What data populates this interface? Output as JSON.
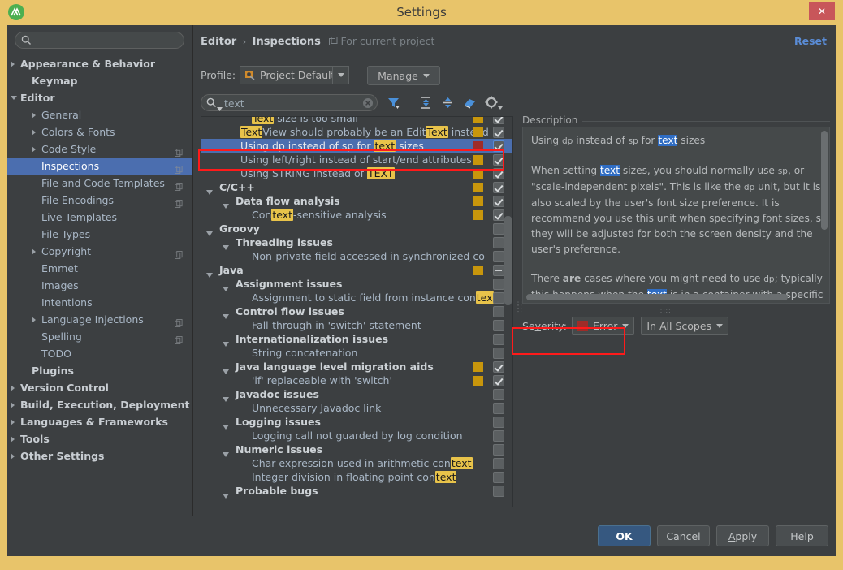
{
  "window": {
    "title": "Settings",
    "app_icon": "android-studio-icon",
    "close_label": "✕"
  },
  "sidebar": {
    "search_placeholder": "",
    "search_value": "",
    "items": [
      {
        "label": "Appearance & Behavior",
        "indent": 16,
        "arrow": "closed",
        "bold": true,
        "selected": false,
        "copy": false
      },
      {
        "label": "Keymap",
        "indent": 30,
        "arrow": "none",
        "bold": true,
        "selected": false,
        "copy": false
      },
      {
        "label": "Editor",
        "indent": 16,
        "arrow": "open",
        "bold": true,
        "selected": false,
        "copy": false
      },
      {
        "label": "General",
        "indent": 42,
        "arrow": "closed",
        "bold": false,
        "selected": false,
        "copy": false
      },
      {
        "label": "Colors & Fonts",
        "indent": 42,
        "arrow": "closed",
        "bold": false,
        "selected": false,
        "copy": false
      },
      {
        "label": "Code Style",
        "indent": 42,
        "arrow": "closed",
        "bold": false,
        "selected": false,
        "copy": true
      },
      {
        "label": "Inspections",
        "indent": 42,
        "arrow": "none",
        "bold": false,
        "selected": true,
        "copy": true
      },
      {
        "label": "File and Code Templates",
        "indent": 42,
        "arrow": "none",
        "bold": false,
        "selected": false,
        "copy": true
      },
      {
        "label": "File Encodings",
        "indent": 42,
        "arrow": "none",
        "bold": false,
        "selected": false,
        "copy": true
      },
      {
        "label": "Live Templates",
        "indent": 42,
        "arrow": "none",
        "bold": false,
        "selected": false,
        "copy": false
      },
      {
        "label": "File Types",
        "indent": 42,
        "arrow": "none",
        "bold": false,
        "selected": false,
        "copy": false
      },
      {
        "label": "Copyright",
        "indent": 42,
        "arrow": "closed",
        "bold": false,
        "selected": false,
        "copy": true
      },
      {
        "label": "Emmet",
        "indent": 42,
        "arrow": "none",
        "bold": false,
        "selected": false,
        "copy": false
      },
      {
        "label": "Images",
        "indent": 42,
        "arrow": "none",
        "bold": false,
        "selected": false,
        "copy": false
      },
      {
        "label": "Intentions",
        "indent": 42,
        "arrow": "none",
        "bold": false,
        "selected": false,
        "copy": false
      },
      {
        "label": "Language Injections",
        "indent": 42,
        "arrow": "closed",
        "bold": false,
        "selected": false,
        "copy": true
      },
      {
        "label": "Spelling",
        "indent": 42,
        "arrow": "none",
        "bold": false,
        "selected": false,
        "copy": true
      },
      {
        "label": "TODO",
        "indent": 42,
        "arrow": "none",
        "bold": false,
        "selected": false,
        "copy": false
      },
      {
        "label": "Plugins",
        "indent": 30,
        "arrow": "none",
        "bold": true,
        "selected": false,
        "copy": false
      },
      {
        "label": "Version Control",
        "indent": 16,
        "arrow": "closed",
        "bold": true,
        "selected": false,
        "copy": false
      },
      {
        "label": "Build, Execution, Deployment",
        "indent": 16,
        "arrow": "closed",
        "bold": true,
        "selected": false,
        "copy": false
      },
      {
        "label": "Languages & Frameworks",
        "indent": 16,
        "arrow": "closed",
        "bold": true,
        "selected": false,
        "copy": false
      },
      {
        "label": "Tools",
        "indent": 16,
        "arrow": "closed",
        "bold": true,
        "selected": false,
        "copy": false
      },
      {
        "label": "Other Settings",
        "indent": 16,
        "arrow": "closed",
        "bold": true,
        "selected": false,
        "copy": false
      }
    ]
  },
  "header": {
    "breadcrumb_root": "Editor",
    "breadcrumb_sep": "›",
    "breadcrumb_leaf": "Inspections",
    "scope_note": "For current project",
    "reset_label": "Reset"
  },
  "profile": {
    "label": "Profile:",
    "selected": "Project Default",
    "manage_label": "Manage"
  },
  "inspection_search": {
    "value": "text",
    "clear_icon": "clear-icon",
    "toolbar": [
      {
        "icon": "filter-icon",
        "name": "filter-inspections-button"
      },
      {
        "icon": "expand-all-icon",
        "name": "expand-all-button"
      },
      {
        "icon": "collapse-all-icon",
        "name": "collapse-all-button"
      },
      {
        "icon": "eraser-icon",
        "name": "reset-to-defaults-button"
      },
      {
        "icon": "gear-icon",
        "name": "settings-button"
      }
    ]
  },
  "tree": {
    "rows": [
      {
        "indent": 62,
        "arrow": "none",
        "group": false,
        "selected": false,
        "clipped_top": true,
        "parts": [
          {
            "t": "Text",
            "hl": true
          },
          {
            "t": " size is too small",
            "hl": false
          }
        ],
        "severity": "warning",
        "check": "checked"
      },
      {
        "indent": 48,
        "arrow": "none",
        "group": false,
        "selected": false,
        "parts": [
          {
            "t": "Text",
            "hl": true
          },
          {
            "t": "View should probably be an Edit",
            "hl": false
          },
          {
            "t": "Text",
            "hl": true
          },
          {
            "t": " instead",
            "hl": false
          }
        ],
        "severity": "warning",
        "check": "checked"
      },
      {
        "indent": 48,
        "arrow": "none",
        "group": false,
        "selected": true,
        "parts": [
          {
            "t": "Using dp instead of sp for ",
            "hl": false
          },
          {
            "t": "text",
            "hl": true
          },
          {
            "t": " sizes",
            "hl": false
          }
        ],
        "severity": "error",
        "check": "checked-blue"
      },
      {
        "indent": 48,
        "arrow": "none",
        "group": false,
        "selected": false,
        "parts": [
          {
            "t": "Using left/right instead of start/end attributes",
            "hl": false
          }
        ],
        "severity": "warning",
        "check": "checked"
      },
      {
        "indent": 48,
        "arrow": "none",
        "group": false,
        "selected": false,
        "parts": [
          {
            "t": "Using STRING instead of ",
            "hl": false
          },
          {
            "t": "TEXT",
            "hl": true
          }
        ],
        "severity": "warning",
        "check": "checked"
      },
      {
        "indent": 22,
        "arrow": "open",
        "group": true,
        "selected": false,
        "parts": [
          {
            "t": "C/C++",
            "hl": false
          }
        ],
        "severity": "warning",
        "check": "checked"
      },
      {
        "indent": 42,
        "arrow": "open",
        "group": true,
        "selected": false,
        "parts": [
          {
            "t": "Data flow analysis",
            "hl": false
          }
        ],
        "severity": "warning",
        "check": "checked"
      },
      {
        "indent": 62,
        "arrow": "none",
        "group": false,
        "selected": false,
        "parts": [
          {
            "t": "Con",
            "hl": false
          },
          {
            "t": "text",
            "hl": true
          },
          {
            "t": "-sensitive analysis",
            "hl": false
          }
        ],
        "severity": "warning",
        "check": "checked"
      },
      {
        "indent": 22,
        "arrow": "open",
        "group": true,
        "selected": false,
        "parts": [
          {
            "t": "Groovy",
            "hl": false
          }
        ],
        "severity": "none",
        "check": "empty"
      },
      {
        "indent": 42,
        "arrow": "open",
        "group": true,
        "selected": false,
        "parts": [
          {
            "t": "Threading issues",
            "hl": false
          }
        ],
        "severity": "none",
        "check": "empty"
      },
      {
        "indent": 62,
        "arrow": "none",
        "group": false,
        "selected": false,
        "parts": [
          {
            "t": "Non-private field accessed in synchronized co",
            "hl": false
          }
        ],
        "severity": "none",
        "check": "empty"
      },
      {
        "indent": 22,
        "arrow": "open",
        "group": true,
        "selected": false,
        "parts": [
          {
            "t": "Java",
            "hl": false
          }
        ],
        "severity": "warning",
        "check": "dash"
      },
      {
        "indent": 42,
        "arrow": "open",
        "group": true,
        "selected": false,
        "parts": [
          {
            "t": "Assignment issues",
            "hl": false
          }
        ],
        "severity": "none",
        "check": "empty"
      },
      {
        "indent": 62,
        "arrow": "none",
        "group": false,
        "selected": false,
        "parts": [
          {
            "t": "Assignment to static field from instance con",
            "hl": false
          },
          {
            "t": "tex",
            "hl": true
          }
        ],
        "severity": "none",
        "check": "empty"
      },
      {
        "indent": 42,
        "arrow": "open",
        "group": true,
        "selected": false,
        "parts": [
          {
            "t": "Control flow issues",
            "hl": false
          }
        ],
        "severity": "none",
        "check": "empty"
      },
      {
        "indent": 62,
        "arrow": "none",
        "group": false,
        "selected": false,
        "parts": [
          {
            "t": "Fall-through in 'switch' statement",
            "hl": false
          }
        ],
        "severity": "none",
        "check": "empty"
      },
      {
        "indent": 42,
        "arrow": "open",
        "group": true,
        "selected": false,
        "parts": [
          {
            "t": "Internationalization issues",
            "hl": false
          }
        ],
        "severity": "none",
        "check": "empty"
      },
      {
        "indent": 62,
        "arrow": "none",
        "group": false,
        "selected": false,
        "parts": [
          {
            "t": "String concatenation",
            "hl": false
          }
        ],
        "severity": "none",
        "check": "empty"
      },
      {
        "indent": 42,
        "arrow": "open",
        "group": true,
        "selected": false,
        "parts": [
          {
            "t": "Java language level migration aids",
            "hl": false
          }
        ],
        "severity": "warning",
        "check": "checked"
      },
      {
        "indent": 62,
        "arrow": "none",
        "group": false,
        "selected": false,
        "parts": [
          {
            "t": "'if' replaceable with 'switch'",
            "hl": false
          }
        ],
        "severity": "warning",
        "check": "checked"
      },
      {
        "indent": 42,
        "arrow": "open",
        "group": true,
        "selected": false,
        "parts": [
          {
            "t": "Javadoc issues",
            "hl": false
          }
        ],
        "severity": "none",
        "check": "empty"
      },
      {
        "indent": 62,
        "arrow": "none",
        "group": false,
        "selected": false,
        "parts": [
          {
            "t": "Unnecessary Javadoc link",
            "hl": false
          }
        ],
        "severity": "none",
        "check": "empty"
      },
      {
        "indent": 42,
        "arrow": "open",
        "group": true,
        "selected": false,
        "parts": [
          {
            "t": "Logging issues",
            "hl": false
          }
        ],
        "severity": "none",
        "check": "empty"
      },
      {
        "indent": 62,
        "arrow": "none",
        "group": false,
        "selected": false,
        "parts": [
          {
            "t": "Logging call not guarded by log condition",
            "hl": false
          }
        ],
        "severity": "none",
        "check": "empty"
      },
      {
        "indent": 42,
        "arrow": "open",
        "group": true,
        "selected": false,
        "parts": [
          {
            "t": "Numeric issues",
            "hl": false
          }
        ],
        "severity": "none",
        "check": "empty"
      },
      {
        "indent": 62,
        "arrow": "none",
        "group": false,
        "selected": false,
        "parts": [
          {
            "t": "Char expression used in arithmetic con",
            "hl": false
          },
          {
            "t": "text",
            "hl": true
          }
        ],
        "severity": "none",
        "check": "empty"
      },
      {
        "indent": 62,
        "arrow": "none",
        "group": false,
        "selected": false,
        "parts": [
          {
            "t": "Integer division in floating point con",
            "hl": false
          },
          {
            "t": "text",
            "hl": true
          }
        ],
        "severity": "none",
        "check": "empty"
      },
      {
        "indent": 42,
        "arrow": "open",
        "group": true,
        "selected": false,
        "parts": [
          {
            "t": "Probable bugs",
            "hl": false
          }
        ],
        "severity": "none",
        "check": "empty"
      }
    ]
  },
  "description": {
    "title": "Description",
    "heading": [
      {
        "t": "Using ",
        "hl": "none"
      },
      {
        "t": "dp",
        "hl": "sm"
      },
      {
        "t": " instead of ",
        "hl": "none"
      },
      {
        "t": "sp",
        "hl": "sm"
      },
      {
        "t": " for ",
        "hl": "none"
      },
      {
        "t": "text",
        "hl": "blue"
      },
      {
        "t": " sizes",
        "hl": "none"
      }
    ],
    "paragraph1": [
      {
        "t": "When setting ",
        "hl": "none"
      },
      {
        "t": "text",
        "hl": "blue"
      },
      {
        "t": " sizes, you should normally use ",
        "hl": "none"
      },
      {
        "t": "sp",
        "hl": "sm"
      },
      {
        "t": ", or \"scale-independent pixels\". This is like the ",
        "hl": "none"
      },
      {
        "t": "dp",
        "hl": "sm"
      },
      {
        "t": " unit, but it is also scaled by the user's font size preference. It is recommend you use this unit when specifying font sizes, so they will be adjusted for both the screen density and the user's preference.",
        "hl": "none"
      }
    ],
    "paragraph2": [
      {
        "t": "There ",
        "hl": "none"
      },
      {
        "t": "are",
        "hl": "bold"
      },
      {
        "t": " cases where you might need to use ",
        "hl": "none"
      },
      {
        "t": "dp",
        "hl": "sm"
      },
      {
        "t": "; typically this happens when the ",
        "hl": "none"
      },
      {
        "t": "text",
        "hl": "blue"
      },
      {
        "t": " is in a container with a specific dp-size. Th",
        "hl": "none"
      }
    ]
  },
  "severity_row": {
    "label": "Severity:",
    "label_pre": "Se",
    "label_underlined": "v",
    "label_post": "erity:",
    "value": "Error",
    "swatch_color": "#9f2c28",
    "scope_value": "In All Scopes"
  },
  "footer": {
    "ok": "OK",
    "cancel": "Cancel",
    "apply_pre": "",
    "apply_underlined": "A",
    "apply_post": "pply",
    "help": "Help"
  },
  "colors": {
    "titlebar": "#e8c46a",
    "panel": "#3c3f41",
    "selection": "#4b6eaf",
    "accent_link": "#5a8cd6",
    "highlight": "#e8c34a",
    "severity_warning": "#c8960c",
    "severity_error": "#9f2c28",
    "annotation": "#ff1a1a"
  }
}
